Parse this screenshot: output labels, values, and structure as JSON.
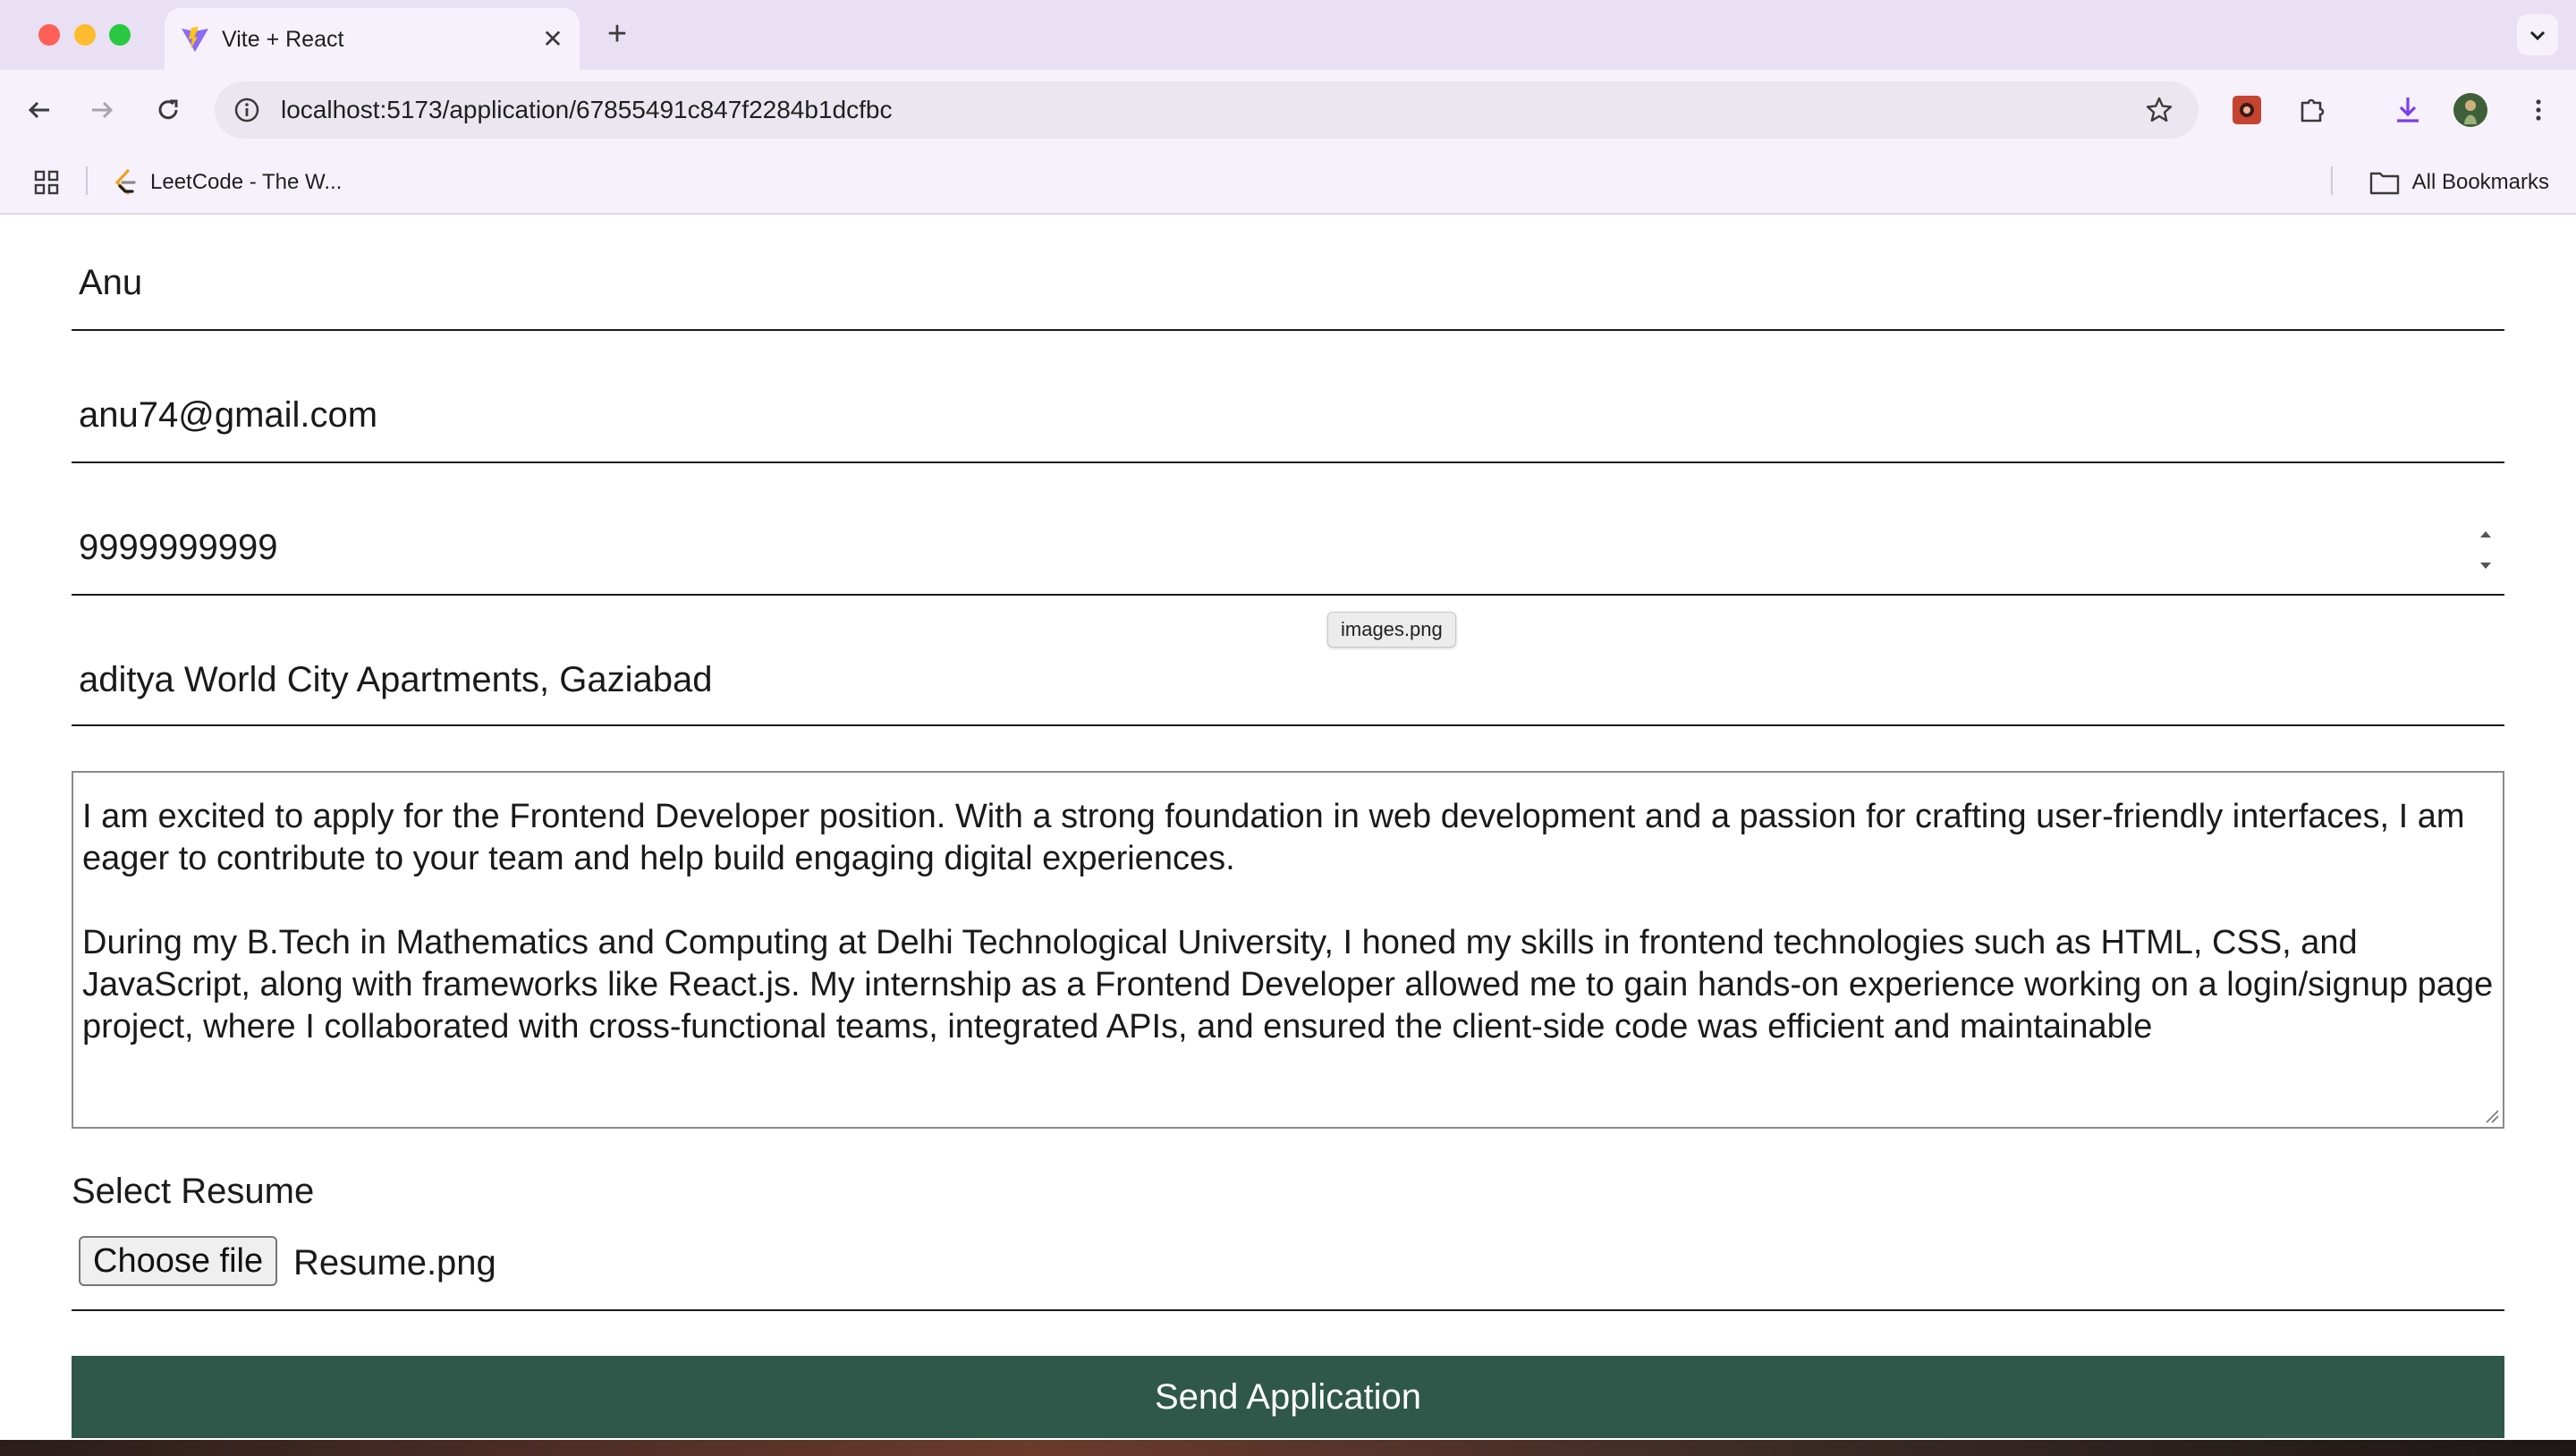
{
  "browser": {
    "tab_title": "Vite + React",
    "url": "localhost:5173/application/67855491c847f2284b1dcfbc",
    "bookmarks": [
      {
        "label": "LeetCode - The W...",
        "icon": "leetcode-icon"
      }
    ],
    "all_bookmarks_label": "All Bookmarks"
  },
  "form": {
    "name_value": "Anu",
    "email_value": "anu74@gmail.com",
    "phone_value": "9999999999",
    "address_value": "aditya World City Apartments, Gaziabad",
    "drag_tooltip": "images.png",
    "cover_letter_value": "I am excited to apply for the Frontend Developer position. With a strong foundation in web development and a passion for crafting user-friendly interfaces, I am eager to contribute to your team and help build engaging digital experiences.\n\nDuring my B.Tech in Mathematics and Computing at Delhi Technological University, I honed my skills in frontend technologies such as HTML, CSS, and JavaScript, along with frameworks like React.js. My internship as a Frontend Developer allowed me to gain hands-on experience working on a login/signup page project, where I collaborated with cross-functional teams, integrated APIs, and ensured the client-side code was efficient and maintainable",
    "resume_label": "Select Resume",
    "choose_file_label": "Choose file",
    "selected_file": "Resume.png",
    "submit_label": "Send Application"
  },
  "colors": {
    "submit_bg": "#2f584a",
    "tabstrip_bg": "#e9e0f3",
    "toolbar_bg": "#f7f1fb"
  }
}
